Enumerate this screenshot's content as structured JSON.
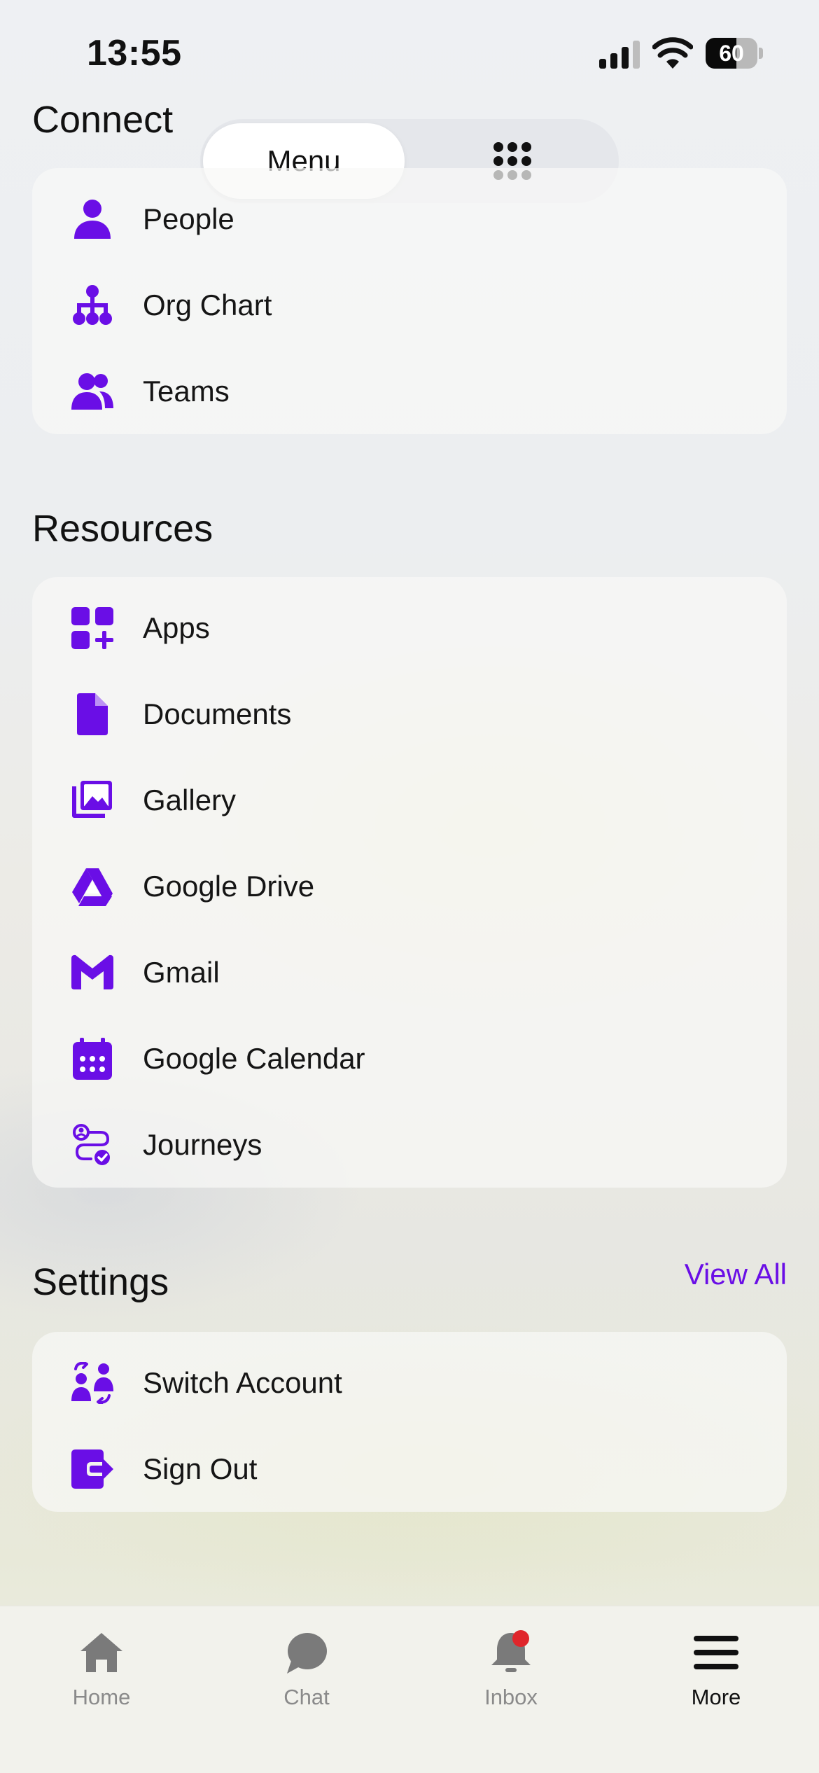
{
  "status_bar": {
    "time": "13:55",
    "battery_level": "60",
    "battery_fraction": 0.6
  },
  "segmented": {
    "menu_label": "Menu",
    "grid_icon": "grid-dots-icon"
  },
  "colors": {
    "accent": "#6a0ee6",
    "badge": "#e0262b",
    "tab_inactive": "#8a8a8a",
    "tab_active": "#111111"
  },
  "connect": {
    "title": "Connect",
    "items": [
      {
        "label": "People",
        "icon": "person-icon"
      },
      {
        "label": "Org Chart",
        "icon": "org-chart-icon"
      },
      {
        "label": "Teams",
        "icon": "teams-icon"
      }
    ]
  },
  "resources": {
    "title": "Resources",
    "items": [
      {
        "label": "Apps",
        "icon": "apps-icon"
      },
      {
        "label": "Documents",
        "icon": "document-icon"
      },
      {
        "label": "Gallery",
        "icon": "gallery-icon"
      },
      {
        "label": "Google Drive",
        "icon": "google-drive-icon"
      },
      {
        "label": "Gmail",
        "icon": "gmail-icon"
      },
      {
        "label": "Google Calendar",
        "icon": "calendar-icon"
      },
      {
        "label": "Journeys",
        "icon": "journeys-icon"
      }
    ]
  },
  "settings": {
    "title": "Settings",
    "view_all": "View All",
    "items": [
      {
        "label": "Switch Account",
        "icon": "switch-account-icon"
      },
      {
        "label": "Sign Out",
        "icon": "sign-out-icon"
      }
    ]
  },
  "tabbar": {
    "items": [
      {
        "label": "Home",
        "icon": "home-icon"
      },
      {
        "label": "Chat",
        "icon": "chat-icon"
      },
      {
        "label": "Inbox",
        "icon": "bell-icon"
      },
      {
        "label": "More",
        "icon": "hamburger-icon"
      }
    ]
  }
}
